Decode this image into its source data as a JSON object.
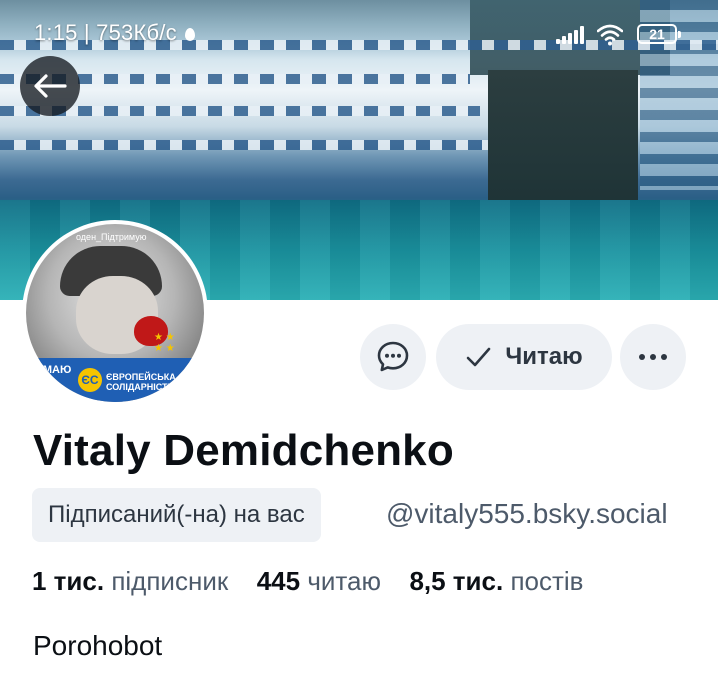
{
  "status_bar": {
    "time_speed": "1:15 | 753Кб/с",
    "battery": "21"
  },
  "banner": {
    "description_icon": "banner-image"
  },
  "avatar": {
    "top_text": "оден_Підтримую",
    "left_text": "УМАЮ",
    "badge": "ЄС",
    "party_line1": "ЄВРОПЕЙСЬКА",
    "party_line2": "СОЛІДАРНІСТЬ"
  },
  "actions": {
    "message_icon": "chat-bubble-icon",
    "follow_label": "Читаю",
    "more_icon": "ellipsis-icon"
  },
  "profile": {
    "display_name": "Vitaly Demidchenko",
    "follows_you": "Підписаний(-на) на вас",
    "handle": "@vitaly555.bsky.social",
    "bio": "Porohobot"
  },
  "stats": {
    "followers_count": "1 тис.",
    "followers_label": "підписник",
    "following_count": "445",
    "following_label": "читаю",
    "posts_count": "8,5 тис.",
    "posts_label": "постів"
  },
  "colors": {
    "button_bg": "#eef1f5",
    "text_primary": "#0b0f14",
    "text_secondary": "#4d5a6a"
  }
}
